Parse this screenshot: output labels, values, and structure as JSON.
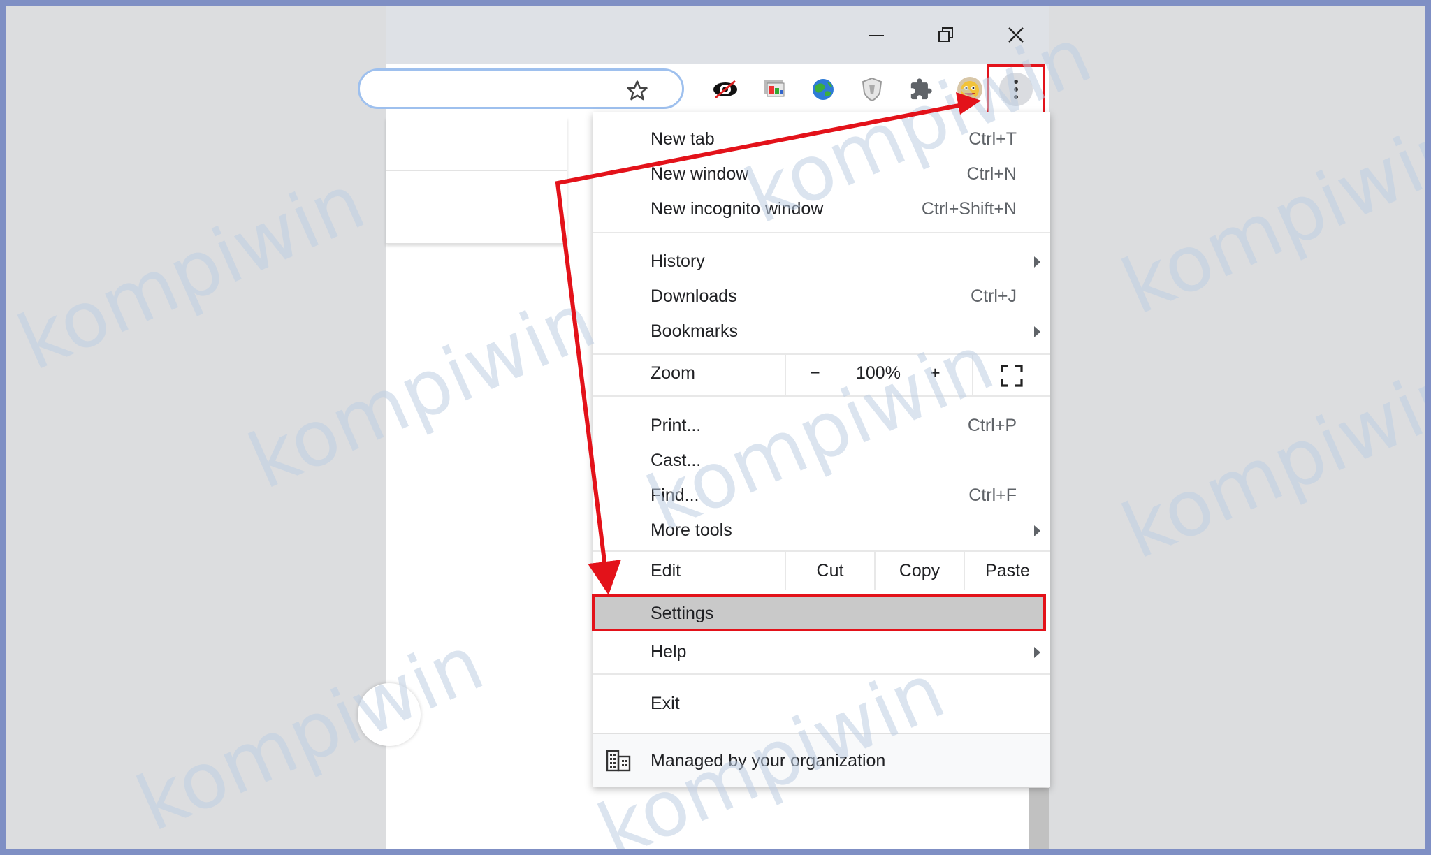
{
  "toolbar": {
    "icons": [
      "bookmark-star-icon",
      "eye-extension-icon",
      "screen-extension-icon",
      "globe-extension-icon",
      "shield-extension-icon",
      "puzzle-extensions-icon",
      "profile-avatar",
      "more-menu-icon"
    ]
  },
  "menu": {
    "new_tab": {
      "label": "New tab",
      "shortcut": "Ctrl+T"
    },
    "new_window": {
      "label": "New window",
      "shortcut": "Ctrl+N"
    },
    "new_incognito": {
      "label": "New incognito window",
      "shortcut": "Ctrl+Shift+N"
    },
    "history": {
      "label": "History"
    },
    "downloads": {
      "label": "Downloads",
      "shortcut": "Ctrl+J"
    },
    "bookmarks": {
      "label": "Bookmarks"
    },
    "zoom": {
      "label": "Zoom",
      "minus": "−",
      "value": "100%",
      "plus": "+"
    },
    "print": {
      "label": "Print...",
      "shortcut": "Ctrl+P"
    },
    "cast": {
      "label": "Cast..."
    },
    "find": {
      "label": "Find...",
      "shortcut": "Ctrl+F"
    },
    "more_tools": {
      "label": "More tools"
    },
    "edit": {
      "label": "Edit",
      "cut": "Cut",
      "copy": "Copy",
      "paste": "Paste"
    },
    "settings": {
      "label": "Settings"
    },
    "help": {
      "label": "Help"
    },
    "exit": {
      "label": "Exit"
    },
    "managed": {
      "label": "Managed by your organization"
    }
  },
  "watermark": {
    "text": "kompiwin"
  },
  "colors": {
    "highlight_red": "#e3121a",
    "titlebar": "#dee1e6",
    "frame_border": "#7f8fc4"
  }
}
